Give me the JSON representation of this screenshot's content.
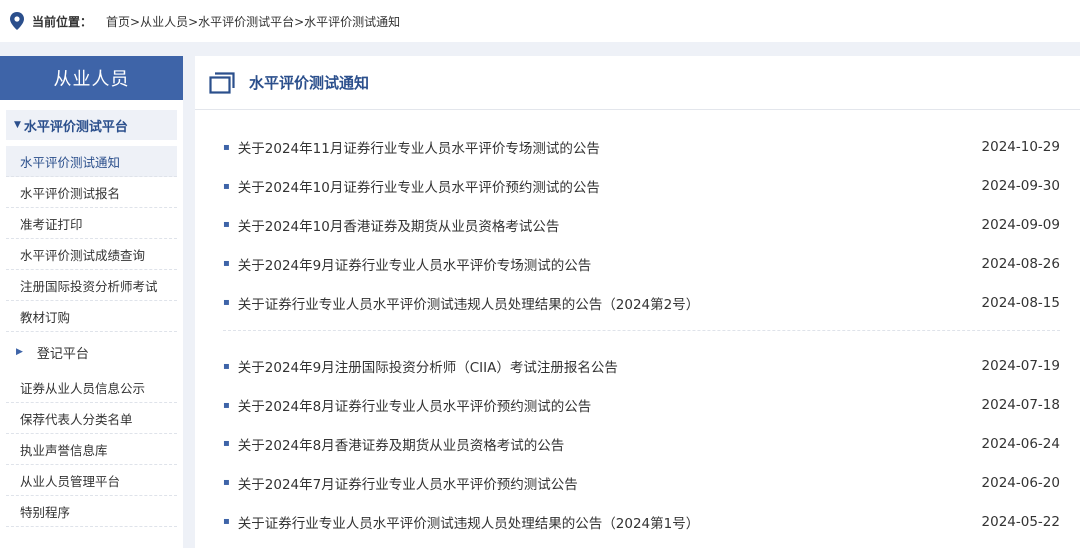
{
  "breadcrumb": {
    "label": "当前位置：",
    "path": "首页>从业人员>水平评价测试平台>水平评价测试通知"
  },
  "sidebar": {
    "header": "从业人员",
    "group_title": "水平评价测试平台",
    "group_items": [
      {
        "label": "水平评价测试通知",
        "active": true
      },
      {
        "label": "水平评价测试报名"
      },
      {
        "label": "准考证打印"
      },
      {
        "label": "水平评价测试成绩查询"
      },
      {
        "label": "注册国际投资分析师考试"
      },
      {
        "label": "教材订购"
      }
    ],
    "collapsed_group": "登记平台",
    "other_items": [
      {
        "label": "证券从业人员信息公示"
      },
      {
        "label": "保荐代表人分类名单"
      },
      {
        "label": "执业声誉信息库"
      },
      {
        "label": "从业人员管理平台"
      },
      {
        "label": "特别程序"
      }
    ]
  },
  "main": {
    "title": "水平评价测试通知",
    "group1": [
      {
        "title": "关于2024年11月证券行业专业人员水平评价专场测试的公告",
        "date": "2024-10-29"
      },
      {
        "title": "关于2024年10月证券行业专业人员水平评价预约测试的公告",
        "date": "2024-09-30"
      },
      {
        "title": "关于2024年10月香港证券及期货从业员资格考试公告",
        "date": "2024-09-09"
      },
      {
        "title": "关于2024年9月证券行业专业人员水平评价专场测试的公告",
        "date": "2024-08-26"
      },
      {
        "title": "关于证券行业专业人员水平评价测试违规人员处理结果的公告（2024第2号）",
        "date": "2024-08-15"
      }
    ],
    "group2": [
      {
        "title": "关于2024年9月注册国际投资分析师（CIIA）考试注册报名公告",
        "date": "2024-07-19"
      },
      {
        "title": "关于2024年8月证券行业专业人员水平评价预约测试的公告",
        "date": "2024-07-18"
      },
      {
        "title": "关于2024年8月香港证券及期货从业员资格考试的公告",
        "date": "2024-06-24"
      },
      {
        "title": "关于2024年7月证券行业专业人员水平评价预约测试公告",
        "date": "2024-06-20"
      },
      {
        "title": "关于证券行业专业人员水平评价测试违规人员处理结果的公告（2024第1号）",
        "date": "2024-05-22"
      }
    ]
  }
}
